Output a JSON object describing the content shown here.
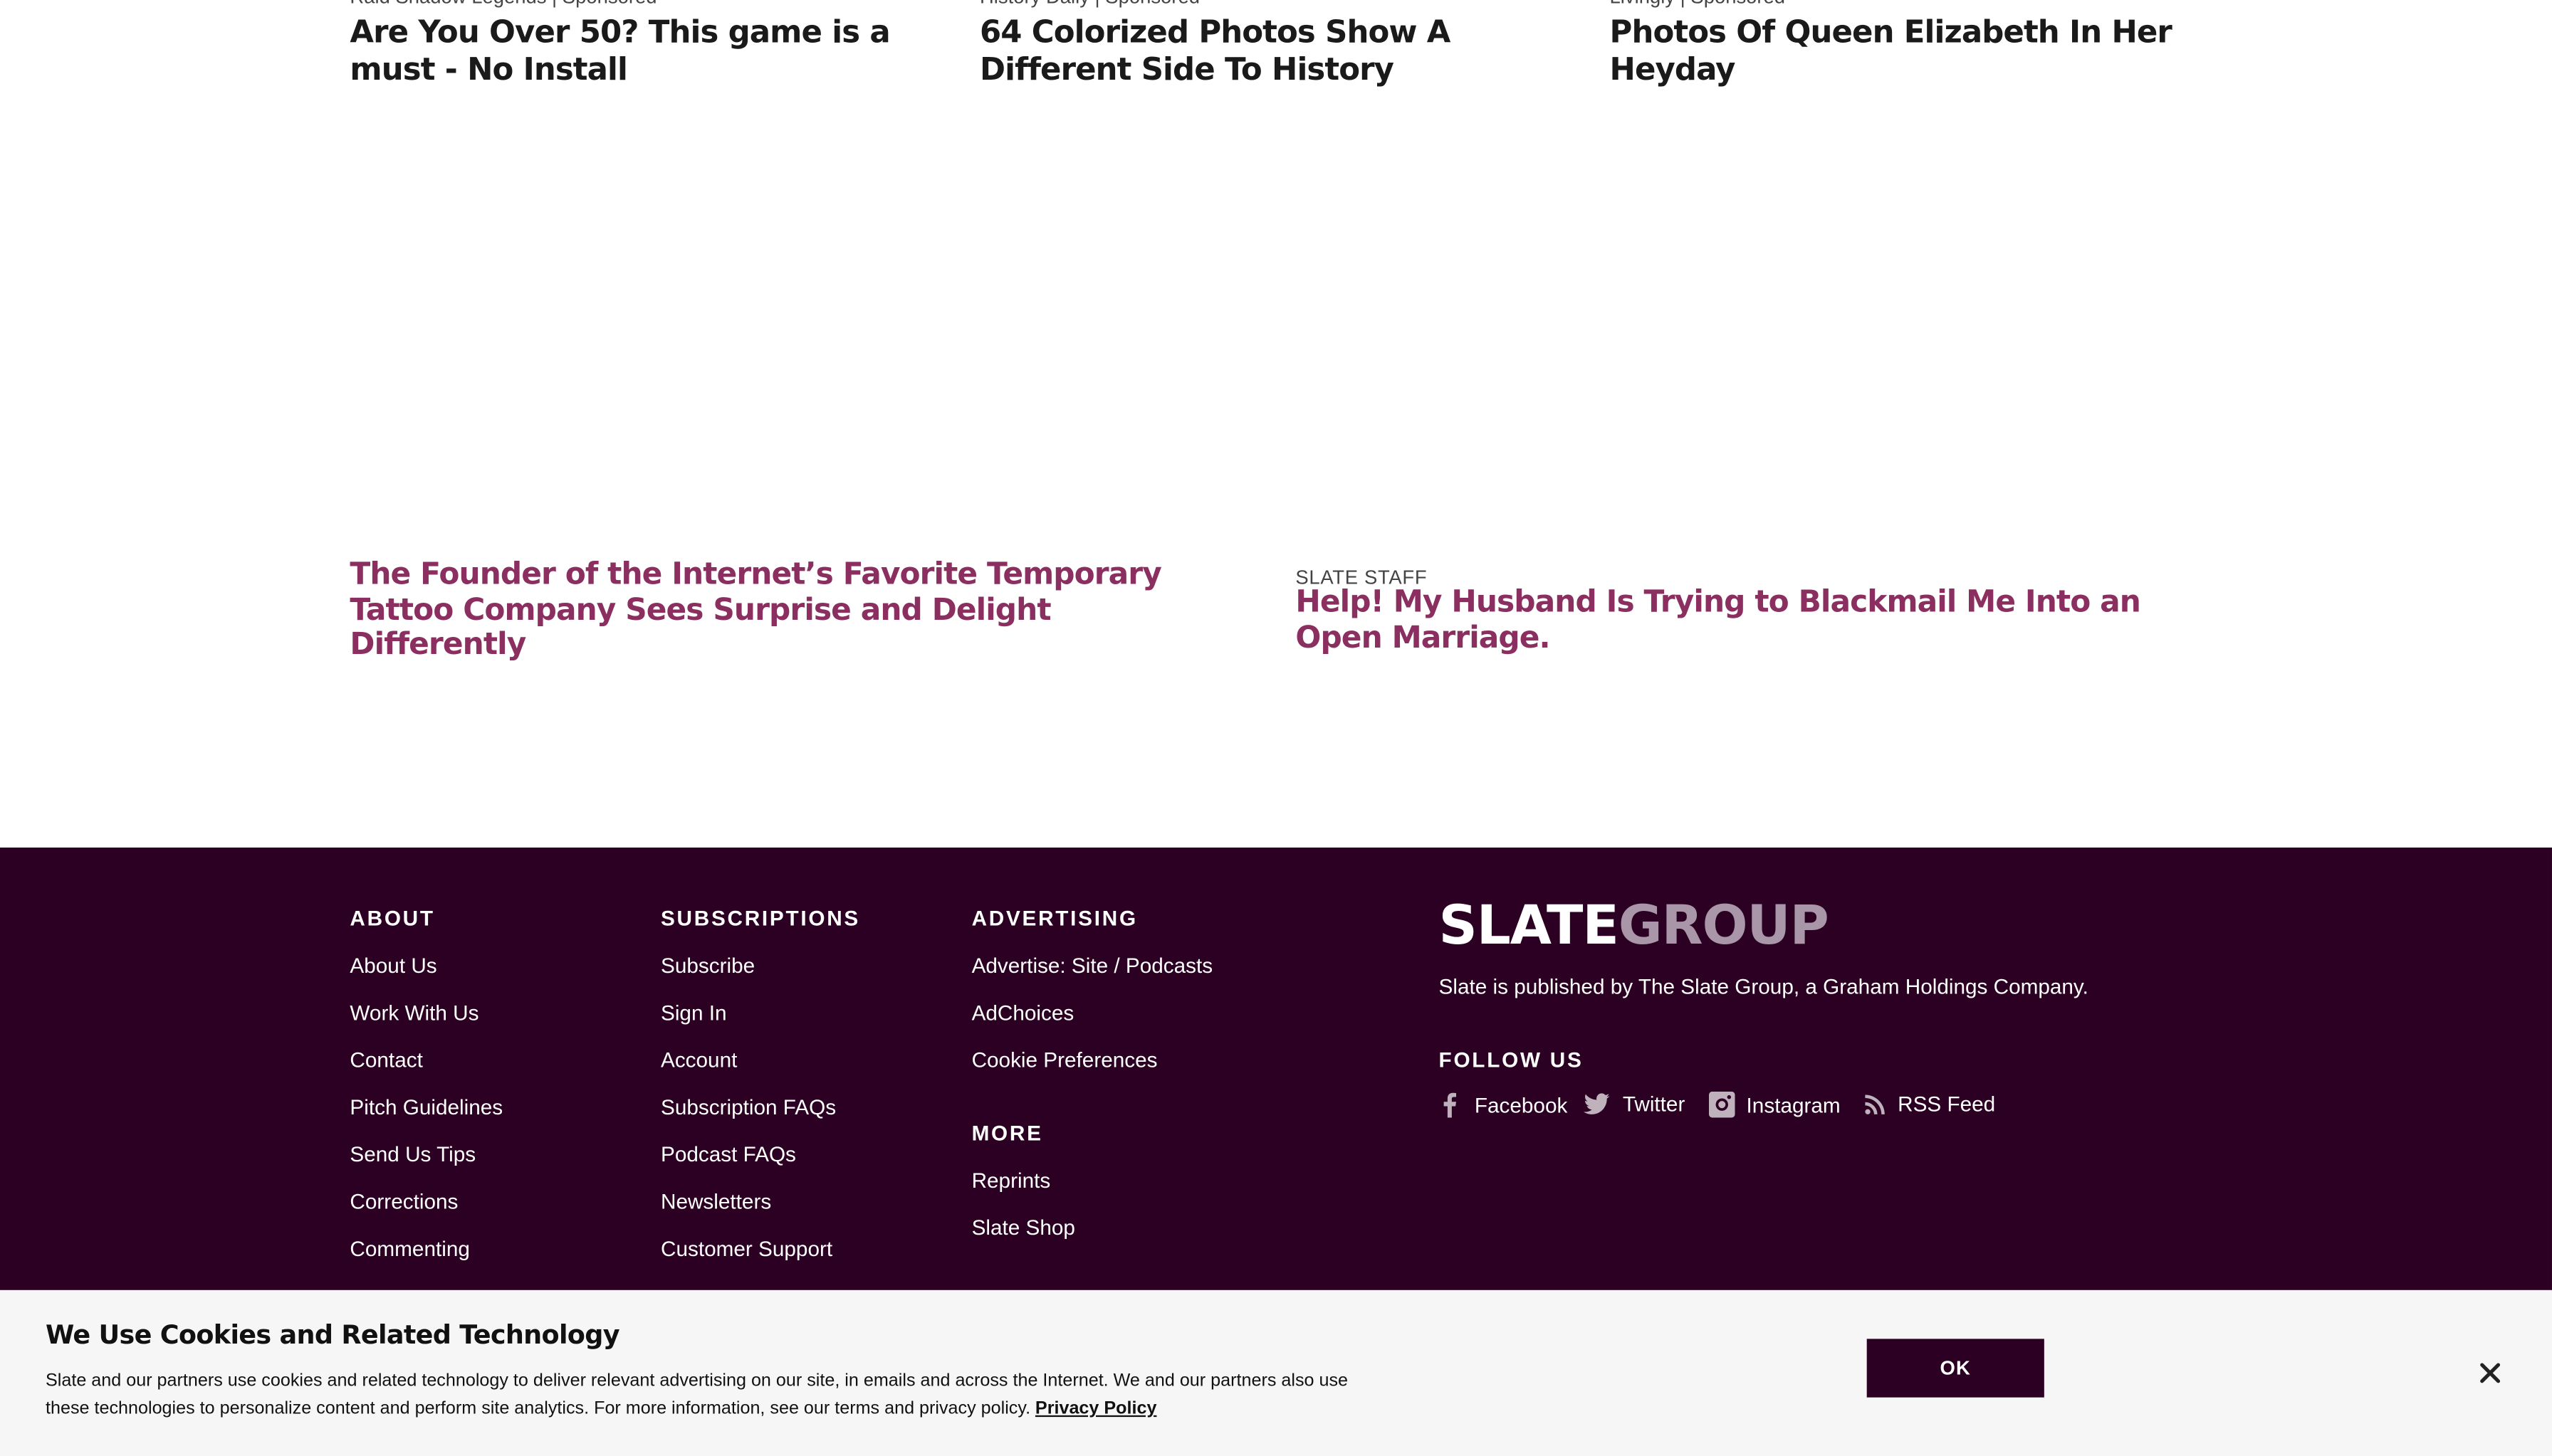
{
  "sponsored": [
    {
      "meta": "Raid Shadow Legends | Sponsored",
      "title": "Are You Over 50? This game is a must - No Install"
    },
    {
      "meta": "History Daily | Sponsored",
      "title": "64 Colorized Photos Show A Different Side To History"
    },
    {
      "meta": "Livingly | Sponsored",
      "title": "Photos Of Queen Elizabeth In Her Heyday"
    }
  ],
  "stories": {
    "left": {
      "title": "The Founder of the Internet’s Favorite Temporary Tattoo Company Sees Surprise and Delight Differently"
    },
    "right": {
      "kicker": "SLATE STAFF",
      "title": "Help! My Husband Is Trying to Blackmail Me Into an Open Marriage."
    }
  },
  "footer": {
    "about": {
      "heading": "ABOUT",
      "links": [
        "About Us",
        "Work With Us",
        "Contact",
        "Pitch Guidelines",
        "Send Us Tips",
        "Corrections",
        "Commenting"
      ]
    },
    "subscriptions": {
      "heading": "SUBSCRIPTIONS",
      "links": [
        "Subscribe",
        "Sign In",
        "Account",
        "Subscription FAQs",
        "Podcast FAQs",
        "Newsletters",
        "Customer Support"
      ]
    },
    "advertising": {
      "heading": "ADVERTISING",
      "links": [
        "Advertise: Site / Podcasts",
        "AdChoices",
        "Cookie Preferences"
      ]
    },
    "more": {
      "heading": "MORE",
      "links": [
        "Reprints",
        "Slate Shop"
      ]
    },
    "logo": {
      "part1": "SLATE",
      "part2": "GROUP"
    },
    "publisher": "Slate is published by The Slate Group, a Graham Holdings Company.",
    "follow_heading": "FOLLOW US",
    "social": [
      {
        "label": "Facebook",
        "icon": "facebook-icon"
      },
      {
        "label": "Twitter",
        "icon": "twitter-icon"
      },
      {
        "label": "Instagram",
        "icon": "instagram-icon"
      },
      {
        "label": "RSS Feed",
        "icon": "rss-icon"
      }
    ]
  },
  "cookie": {
    "title": "We Use Cookies and Related Technology",
    "text": "Slate and our partners use cookies and related technology to deliver relevant advertising on our site, in emails and across the Internet. We and our partners also use these technologies to personalize content and perform site analytics. For more information, see our terms and privacy policy.",
    "link": "Privacy Policy",
    "ok": "OK"
  },
  "colors": {
    "footer_bg": "#2b0022",
    "link": "#8a2f5f",
    "cookie_bg": "#f6f6f6"
  }
}
